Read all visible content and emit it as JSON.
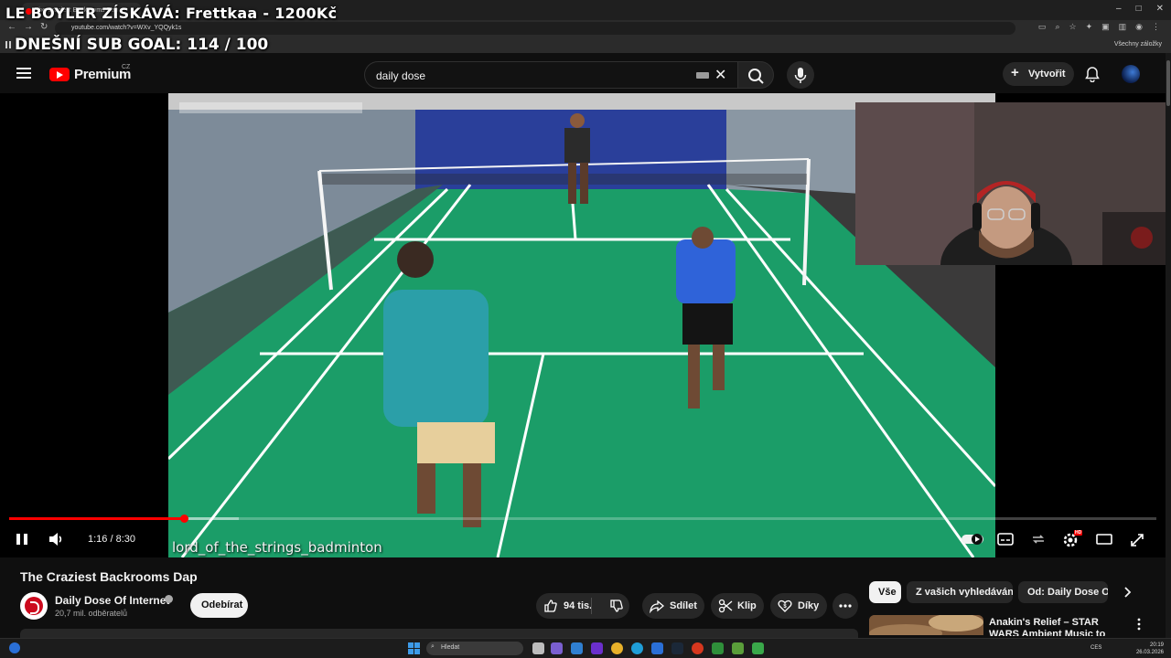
{
  "browser": {
    "tab_title": "The Craziest Backrooms Dap",
    "url": "youtube.com/watch?v=WXv_YQQyk1s",
    "bookmarks_all": "Všechny záložky"
  },
  "stream_overlay": {
    "line1": "LE BOYLER ZÍSKÁVÁ: Frettkaa - 1200Kč",
    "line2": "DNEŠNÍ SUB GOAL: 114 / 100"
  },
  "header": {
    "logo_text": "Premium",
    "country_code": "CZ",
    "search_value": "daily dose",
    "create_label": "Vytvořit"
  },
  "player": {
    "caption": "lord_of_the_strings_badminton",
    "time": "1:16 / 8:30",
    "progress_fraction": 0.152,
    "buffered_fraction": 0.2,
    "hd_badge": "HD"
  },
  "video": {
    "title": "The Craziest Backrooms Dap",
    "channel": "Daily Dose Of Internet",
    "subscribers": "20,7 mil. odběratelů",
    "subscribe_label": "Odebírat",
    "likes": "94 tis.",
    "share_label": "Sdílet",
    "clip_label": "Klip",
    "thanks_label": "Díky"
  },
  "chips": [
    {
      "label": "Vše"
    },
    {
      "label": "Z vašich vyhledávání"
    },
    {
      "label": "Od: Daily Dose Of Internet"
    }
  ],
  "recommendation": {
    "title": "Anakin's Relief – STAR WARS Ambient Music to Find Peace i"
  },
  "taskbar": {
    "search_placeholder": "Hledat",
    "lang": "CES",
    "time": "20:19",
    "date": "26.03.2026"
  },
  "colors": {
    "accent": "#ff0000",
    "background": "#0f0f0f",
    "court": "#1aa06a"
  }
}
